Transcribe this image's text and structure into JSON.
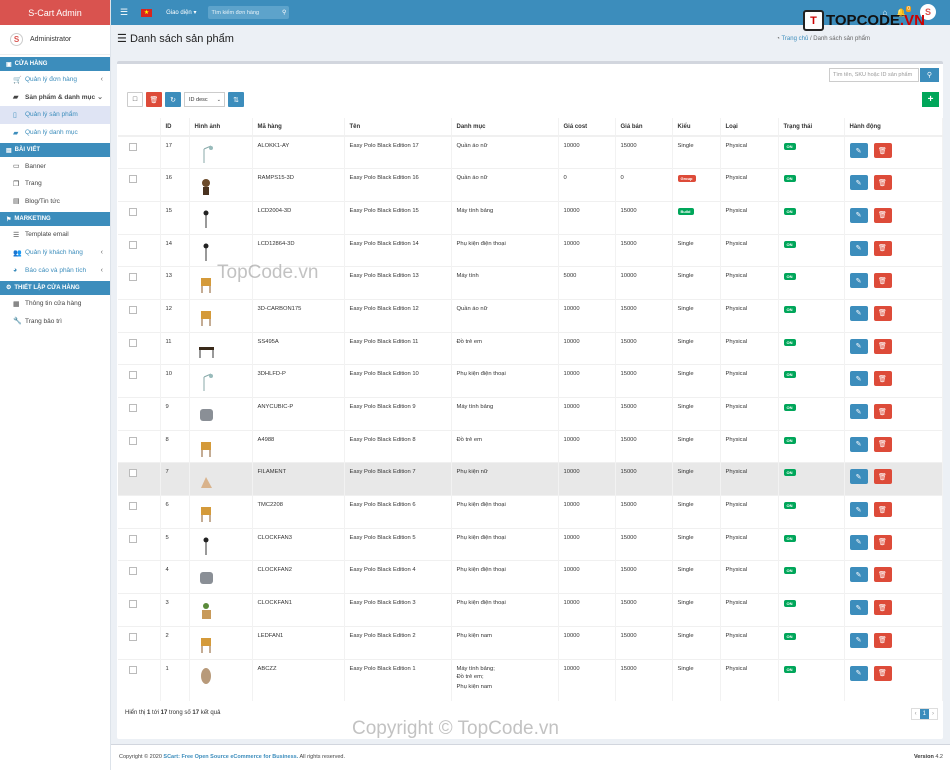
{
  "app": {
    "brand": "S-Cart Admin",
    "user": "Administrator",
    "avatar_letter": "S"
  },
  "sidebar": {
    "sec1": "CỬA HÀNG",
    "orders": "Quản lý đơn hàng",
    "products_cat": "Sản phẩm & danh mục",
    "products": "Quản lý sản phẩm",
    "categories": "Quản lý danh mục",
    "sec2": "BÀI VIẾT",
    "banner": "Banner",
    "page": "Trang",
    "blog": "Blog/Tin tức",
    "sec3": "MARKETING",
    "email_tpl": "Template email",
    "customers": "Quản lý khách hàng",
    "reports": "Báo cáo và phân tích",
    "sec4": "THIẾT LẬP CỬA HÀNG",
    "store_info": "Thông tin cửa hàng",
    "maintenance": "Trang bảo trì"
  },
  "topbar": {
    "theme": "Giao diện",
    "search_placeholder": "Tìm kiếm đơn hàng",
    "notif_count": "0"
  },
  "page": {
    "title": "Danh sách sản phẩm",
    "breadcrumb_home": "Trang chủ",
    "breadcrumb_sep": "/",
    "breadcrumb_current": "Danh sách sản phẩm"
  },
  "search": {
    "placeholder": "Tìm tên, SKU hoặc ID sản phẩm"
  },
  "sort": {
    "selected": "ID desc"
  },
  "table": {
    "headers": [
      "ID",
      "Hình ảnh",
      "Mã hàng",
      "Tên",
      "Danh mục",
      "Giá cost",
      "Giá bán",
      "Kiểu",
      "Loại",
      "Trạng thái",
      "Hành động"
    ],
    "rows": [
      {
        "id": "17",
        "sku": "ALOKK1-AY",
        "name": "Easy Polo Black Edition 17",
        "cat": "Quần áo nữ",
        "cost": "10000",
        "price": "15000",
        "kind": "Single",
        "type": "Physical",
        "status": "ON"
      },
      {
        "id": "16",
        "sku": "RAMPS15-3D",
        "name": "Easy Polo Black Edition 16",
        "cat": "Quần áo nữ",
        "cost": "0",
        "price": "0",
        "kind": "Group",
        "type": "Physical",
        "status": "ON"
      },
      {
        "id": "15",
        "sku": "LCD2004-3D",
        "name": "Easy Polo Black Edition 15",
        "cat": "Máy tính bảng",
        "cost": "10000",
        "price": "15000",
        "kind": "Build",
        "type": "Physical",
        "status": "ON"
      },
      {
        "id": "14",
        "sku": "LCD12864-3D",
        "name": "Easy Polo Black Edition 14",
        "cat": "Phụ kiện điện thoại",
        "cost": "10000",
        "price": "15000",
        "kind": "Single",
        "type": "Physical",
        "status": "ON"
      },
      {
        "id": "13",
        "sku": "",
        "name": "Easy Polo Black Edition 13",
        "cat": "Máy tính",
        "cost": "5000",
        "price": "10000",
        "kind": "Single",
        "type": "Physical",
        "status": "ON"
      },
      {
        "id": "12",
        "sku": "3D-CARBON175",
        "name": "Easy Polo Black Edition 12",
        "cat": "Quần áo nữ",
        "cost": "10000",
        "price": "15000",
        "kind": "Single",
        "type": "Physical",
        "status": "ON"
      },
      {
        "id": "11",
        "sku": "SS495A",
        "name": "Easy Polo Black Edition 11",
        "cat": "Đồ trẻ em",
        "cost": "10000",
        "price": "15000",
        "kind": "Single",
        "type": "Physical",
        "status": "ON"
      },
      {
        "id": "10",
        "sku": "3DHLFD-P",
        "name": "Easy Polo Black Edition 10",
        "cat": "Phụ kiện điện thoại",
        "cost": "10000",
        "price": "15000",
        "kind": "Single",
        "type": "Physical",
        "status": "ON"
      },
      {
        "id": "9",
        "sku": "ANYCUBIC-P",
        "name": "Easy Polo Black Edition 9",
        "cat": "Máy tính bảng",
        "cost": "10000",
        "price": "15000",
        "kind": "Single",
        "type": "Physical",
        "status": "ON"
      },
      {
        "id": "8",
        "sku": "A4988",
        "name": "Easy Polo Black Edition 8",
        "cat": "Đồ trẻ em",
        "cost": "10000",
        "price": "15000",
        "kind": "Single",
        "type": "Physical",
        "status": "ON"
      },
      {
        "id": "7",
        "sku": "FILAMENT",
        "name": "Easy Polo Black Edition 7",
        "cat": "Phụ kiện nữ",
        "cost": "10000",
        "price": "15000",
        "kind": "Single",
        "type": "Physical",
        "status": "ON"
      },
      {
        "id": "6",
        "sku": "TMC2208",
        "name": "Easy Polo Black Edition 6",
        "cat": "Phụ kiện điện thoại",
        "cost": "10000",
        "price": "15000",
        "kind": "Single",
        "type": "Physical",
        "status": "ON"
      },
      {
        "id": "5",
        "sku": "CLOCKFAN3",
        "name": "Easy Polo Black Edition 5",
        "cat": "Phụ kiện điện thoại",
        "cost": "10000",
        "price": "15000",
        "kind": "Single",
        "type": "Physical",
        "status": "ON"
      },
      {
        "id": "4",
        "sku": "CLOCKFAN2",
        "name": "Easy Polo Black Edition 4",
        "cat": "Phụ kiện điện thoại",
        "cost": "10000",
        "price": "15000",
        "kind": "Single",
        "type": "Physical",
        "status": "ON"
      },
      {
        "id": "3",
        "sku": "CLOCKFAN1",
        "name": "Easy Polo Black Edition 3",
        "cat": "Phụ kiện điện thoại",
        "cost": "10000",
        "price": "15000",
        "kind": "Single",
        "type": "Physical",
        "status": "ON"
      },
      {
        "id": "2",
        "sku": "LEDFAN1",
        "name": "Easy Polo Black Edition 2",
        "cat": "Phụ kiện nam",
        "cost": "10000",
        "price": "15000",
        "kind": "Single",
        "type": "Physical",
        "status": "ON"
      },
      {
        "id": "1",
        "sku": "ABCZZ",
        "name": "Easy Polo Black Edition 1",
        "cat": "Máy tính bảng;",
        "cat2": "Đồ trẻ em;",
        "cat3": "Phụ kiện nam",
        "cost": "10000",
        "price": "15000",
        "kind": "Single",
        "type": "Physical",
        "status": "ON"
      }
    ]
  },
  "summary": {
    "pre": "Hiển thị",
    "from": "1",
    "mid1": "tới",
    "to": "17",
    "mid2": "trong số",
    "total": "17",
    "post": "kết quả"
  },
  "pager": {
    "prev": "‹",
    "current": "1",
    "next": "›"
  },
  "footer": {
    "copy_pre": "Copyright © 2020",
    "copy_link": "SCart: Free Open Source eCommerce for Business.",
    "copy_post": "All rights reserved.",
    "version_label": "Version",
    "version": "4.2"
  },
  "watermark": {
    "logo_box": "T",
    "logo_pre": "TOPCODE",
    "logo_post": ".VN",
    "wm1": "TopCode.vn",
    "wm2": "Copyright © TopCode.vn"
  },
  "colors": {
    "brand": "#d9534f",
    "accent": "#3c8dbc",
    "success": "#00a65a",
    "danger": "#dd4b39"
  }
}
